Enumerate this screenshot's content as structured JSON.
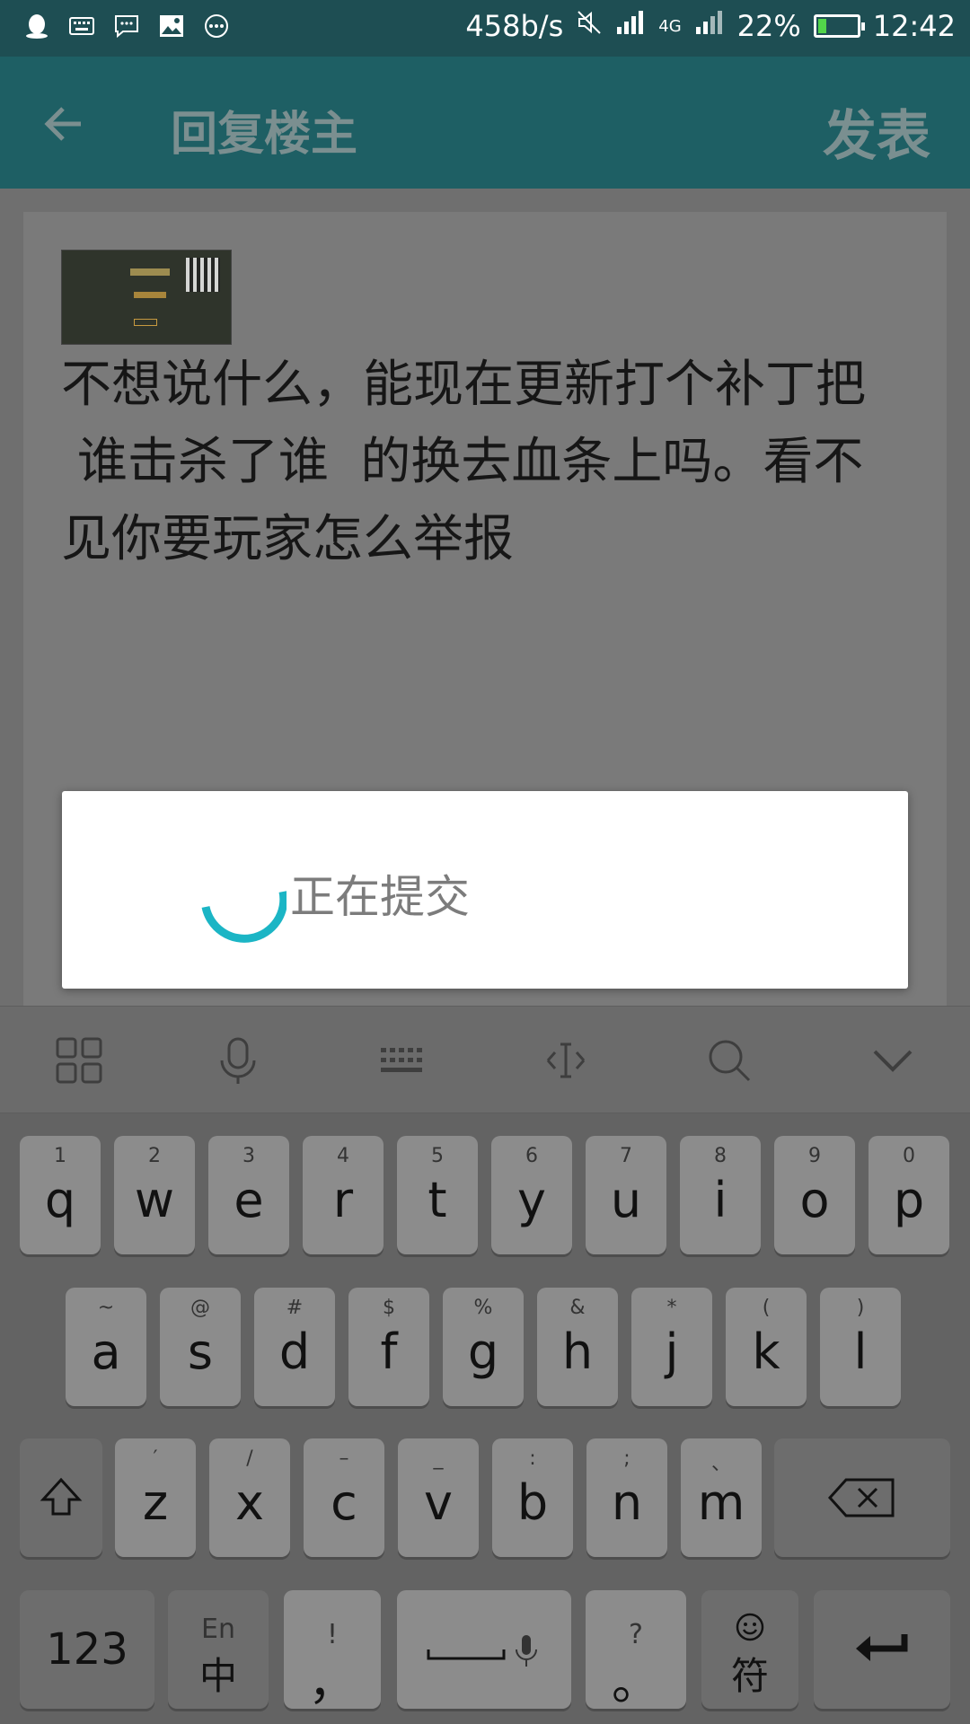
{
  "status_bar": {
    "net_speed": "458b/s",
    "network_type": "4G",
    "battery_percent": "22%",
    "battery_level": 0.22,
    "time": "12:42",
    "left_icons": [
      "qq-icon",
      "keyboard-icon",
      "message-icon",
      "image-icon",
      "more-icon"
    ]
  },
  "app_bar": {
    "back_icon": "arrow-left-icon",
    "title": "回复楼主",
    "publish_label": "发表"
  },
  "post": {
    "text": "不想说什么，能现在更新打个补丁把\n 谁击杀了谁  的换去血条上吗。看不\n见你要玩家怎么举报"
  },
  "dialog": {
    "message": "正在提交",
    "spinner_color": "#1bb5c5"
  },
  "toolbar": {
    "icons": [
      "apps-grid-icon",
      "microphone-icon",
      "keyboard-icon",
      "cursor-icon",
      "search-icon",
      "collapse-icon"
    ]
  },
  "keyboard": {
    "row1": [
      {
        "main": "q",
        "sub": "1"
      },
      {
        "main": "w",
        "sub": "2"
      },
      {
        "main": "e",
        "sub": "3"
      },
      {
        "main": "r",
        "sub": "4"
      },
      {
        "main": "t",
        "sub": "5"
      },
      {
        "main": "y",
        "sub": "6"
      },
      {
        "main": "u",
        "sub": "7"
      },
      {
        "main": "i",
        "sub": "8"
      },
      {
        "main": "o",
        "sub": "9"
      },
      {
        "main": "p",
        "sub": "0"
      }
    ],
    "row2": [
      {
        "main": "a",
        "sub": "~"
      },
      {
        "main": "s",
        "sub": "@"
      },
      {
        "main": "d",
        "sub": "#"
      },
      {
        "main": "f",
        "sub": "$"
      },
      {
        "main": "g",
        "sub": "%"
      },
      {
        "main": "h",
        "sub": "&"
      },
      {
        "main": "j",
        "sub": "*"
      },
      {
        "main": "k",
        "sub": "("
      },
      {
        "main": "l",
        "sub": ")"
      }
    ],
    "row3": [
      {
        "main": "z",
        "sub": "′"
      },
      {
        "main": "x",
        "sub": "/"
      },
      {
        "main": "c",
        "sub": "–"
      },
      {
        "main": "v",
        "sub": "_"
      },
      {
        "main": "b",
        "sub": ":"
      },
      {
        "main": "n",
        "sub": ";"
      },
      {
        "main": "m",
        "sub": "、"
      }
    ],
    "num_label": "123",
    "lang_top": "En",
    "lang_bottom": "中",
    "comma_sub": "!",
    "comma_main": "，",
    "period_sub": "?",
    "period_main": "。",
    "symbol_label": "符"
  }
}
